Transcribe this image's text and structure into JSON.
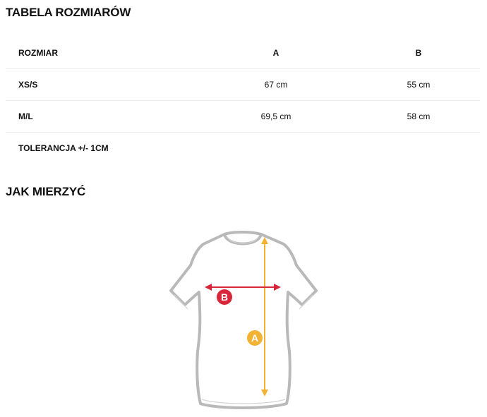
{
  "size_table": {
    "title": "TABELA ROZMIARÓW",
    "headers": [
      "ROZMIAR",
      "A",
      "B"
    ],
    "rows": [
      [
        "XS/S",
        "67 cm",
        "55 cm"
      ],
      [
        "M/L",
        "69,5 cm",
        "58 cm"
      ]
    ],
    "tolerance": "TOLERANCJA +/- 1CM"
  },
  "measure": {
    "title": "JAK MIERZYĆ",
    "label_a": "A",
    "label_b": "B",
    "colors": {
      "a_measure": "#f2b234",
      "b_measure": "#d8263a",
      "shirt_outline": "#b9b9b9"
    }
  }
}
